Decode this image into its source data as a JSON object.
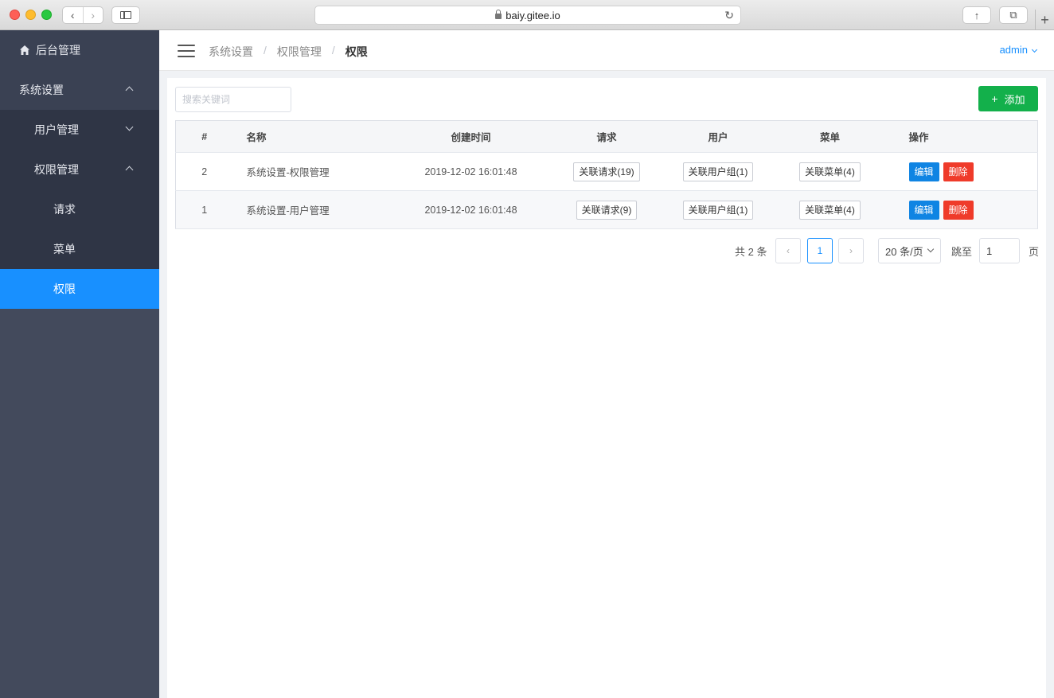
{
  "browser": {
    "url": "baiy.gitee.io",
    "icons": {
      "back": "chevron-left-icon",
      "forward": "chevron-right-icon",
      "reload": "reload-icon",
      "share": "share-icon",
      "tabs": "tabs-icon",
      "new_tab": "plus-icon"
    }
  },
  "sidebar": {
    "top_item": {
      "label": "后台管理",
      "icon": "home-icon"
    },
    "items": [
      {
        "label": "系统设置",
        "level": "group",
        "expanded": true
      },
      {
        "label": "用户管理",
        "level": "sub",
        "expanded": false
      },
      {
        "label": "权限管理",
        "level": "sub",
        "expanded": true
      },
      {
        "label": "请求",
        "level": "leaf"
      },
      {
        "label": "菜单",
        "level": "leaf"
      },
      {
        "label": "权限",
        "level": "leaf",
        "active": true
      }
    ]
  },
  "header": {
    "breadcrumb": [
      "系统设置",
      "权限管理",
      "权限"
    ],
    "separator": "/",
    "user": "admin"
  },
  "toolbar": {
    "search_placeholder": "搜索关键词",
    "add_label": "添加",
    "add_icon": "plus-icon"
  },
  "table": {
    "columns": [
      "#",
      "名称",
      "创建时间",
      "请求",
      "用户",
      "菜单",
      "操作"
    ],
    "rows": [
      {
        "id": "2",
        "name": "系统设置-权限管理",
        "created": "2019-12-02 16:01:48",
        "request": "关联请求(19)",
        "user": "关联用户组(1)",
        "menu": "关联菜单(4)",
        "edit": "编辑",
        "delete": "删除"
      },
      {
        "id": "1",
        "name": "系统设置-用户管理",
        "created": "2019-12-02 16:01:48",
        "request": "关联请求(9)",
        "user": "关联用户组(1)",
        "menu": "关联菜单(4)",
        "edit": "编辑",
        "delete": "删除"
      }
    ]
  },
  "pagination": {
    "total": "共 2 条",
    "current_page": "1",
    "page_size": "20 条/页",
    "jump_label": "跳至",
    "jump_value": "1",
    "page_suffix": "页"
  },
  "colors": {
    "sidebar_bg": "#434a5c",
    "sidebar_sub_bg": "#2f3545",
    "active": "#1890ff",
    "add_button": "#13b04b",
    "edit_button": "#0f84e3",
    "delete_button": "#ef3b2a"
  }
}
